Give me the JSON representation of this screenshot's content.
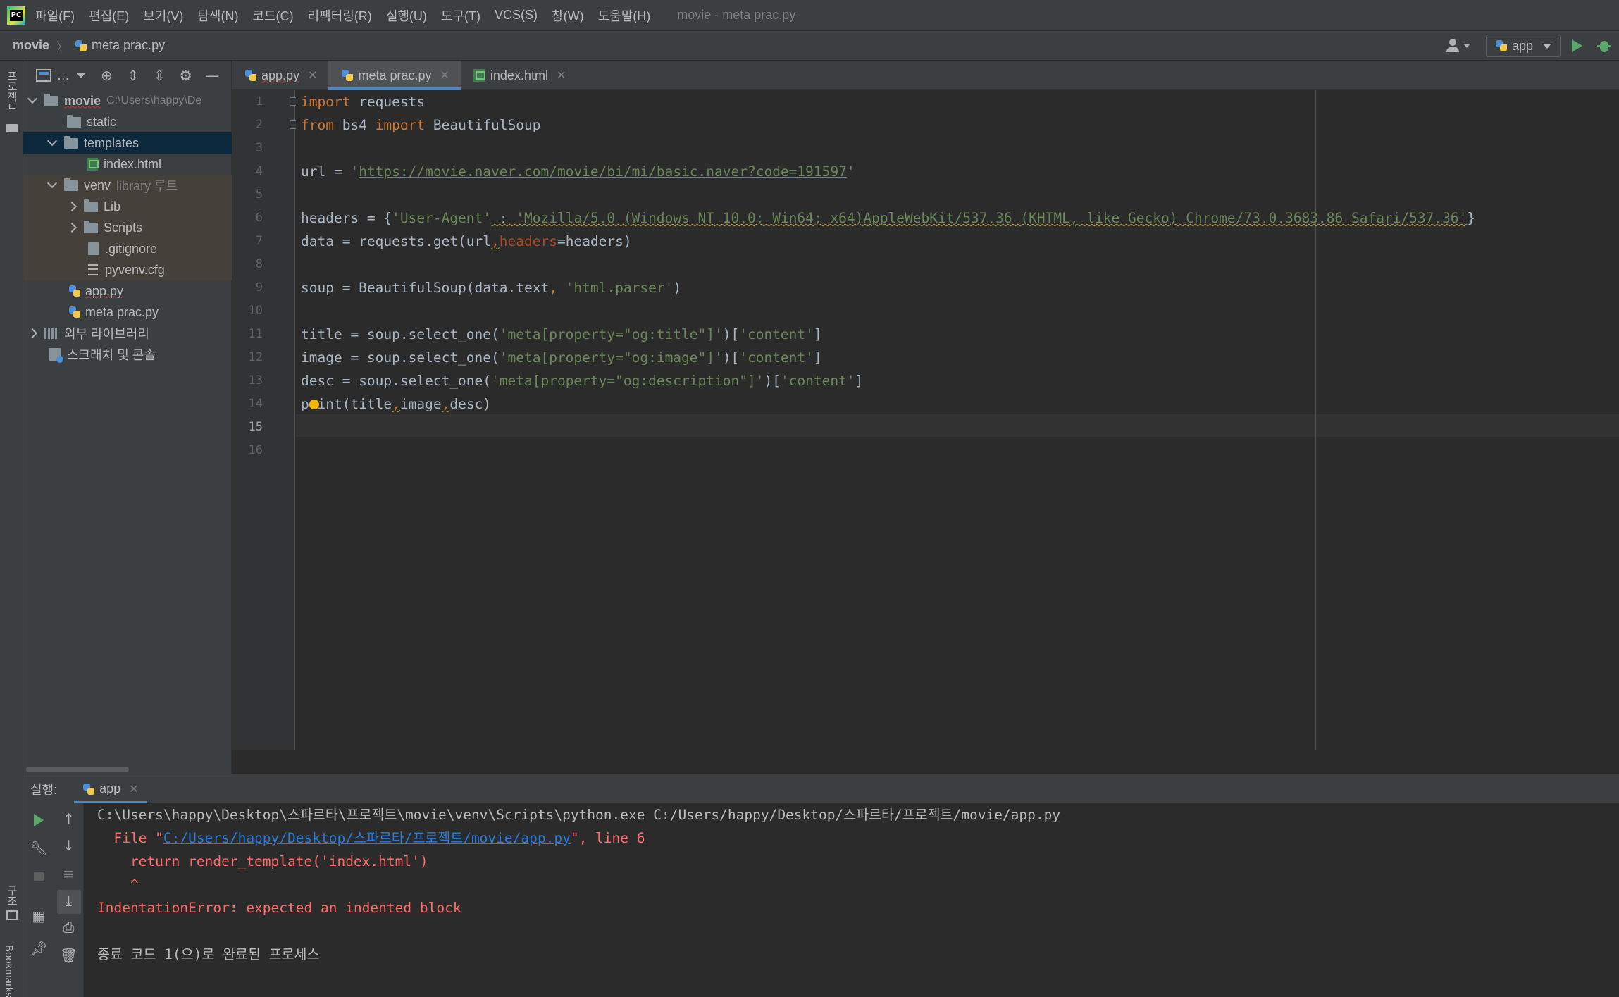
{
  "menubar": {
    "items": [
      "파일(F)",
      "편집(E)",
      "보기(V)",
      "탐색(N)",
      "코드(C)",
      "리팩터링(R)",
      "실행(U)",
      "도구(T)",
      "VCS(S)",
      "창(W)",
      "도움말(H)"
    ],
    "window_title": "movie - meta prac.py"
  },
  "navbar": {
    "project": "movie",
    "file": "meta prac.py",
    "run_config": "app"
  },
  "left_strip": {
    "project_label": "프로젝트",
    "structure_label": "구조",
    "bookmarks_label": "Bookmarks"
  },
  "project_tree": {
    "root": {
      "name": "movie",
      "path": "C:\\Users\\happy\\De"
    },
    "static": "static",
    "templates": "templates",
    "index_html": "index.html",
    "venv": {
      "name": "venv",
      "tag": "library 루트"
    },
    "lib": "Lib",
    "scripts": "Scripts",
    "gitignore": ".gitignore",
    "pyvenv": "pyvenv.cfg",
    "app_py": "app.py",
    "meta_prac": "meta prac.py",
    "external_libs": "외부 라이브러리",
    "scratches": "스크래치 및 콘솔"
  },
  "tabs": [
    {
      "label": "app.py"
    },
    {
      "label": "meta prac.py"
    },
    {
      "label": "index.html"
    }
  ],
  "editor": {
    "line_numbers": [
      "1",
      "2",
      "3",
      "4",
      "5",
      "6",
      "7",
      "8",
      "9",
      "10",
      "11",
      "12",
      "13",
      "14",
      "15",
      "16"
    ],
    "code": {
      "l1_kw": "import",
      "l1_rest": " requests",
      "l2_kw1": "from",
      "l2_mid": " bs4 ",
      "l2_kw2": "import",
      "l2_rest": " BeautifulSoup",
      "l4_a": "url = ",
      "l4_q1": "'",
      "l4_url": "https://movie.naver.com/movie/bi/mi/basic.naver?code=191597",
      "l4_q2": "'",
      "l6_a": "headers = {",
      "l6_key": "'User-Agent'",
      "l6_colon": " : ",
      "l6_val": "'Mozilla/5.0 (Windows NT 10.0; Win64; x64)AppleWebKit/537.36 (KHTML, like Gecko) Chrome/73.0.3683.86 Safari/537.36'",
      "l6_end": "}",
      "l7_a": "data = requests.get(url",
      "l7_comma": ",",
      "l7_param": "headers",
      "l7_rest": "=headers)",
      "l9_a": "soup = BeautifulSoup(data.text",
      "l9_comma": ", ",
      "l9_str": "'html.parser'",
      "l9_end": ")",
      "l11_a": "title = soup.select_one(",
      "l11_s1": "'meta[property=\"og:title\"]'",
      "l11_b": ")[",
      "l11_s2": "'content'",
      "l11_c": "]",
      "l12_a": "image = soup.select_one(",
      "l12_s1": "'meta[property=\"og:image\"]'",
      "l12_b": ")[",
      "l12_s2": "'content'",
      "l12_c": "]",
      "l13_a": "desc = soup.select_one(",
      "l13_s1": "'meta[property=\"og:description\"]'",
      "l13_b": ")[",
      "l13_s2": "'content'",
      "l13_c": "]",
      "l14_a": "print(title",
      "l14_c1": ",",
      "l14_b": "image",
      "l14_c2": ",",
      "l14_d": "desc)"
    }
  },
  "run_panel": {
    "label": "실행:",
    "tab": "app",
    "console": {
      "line1": "C:\\Users\\happy\\Desktop\\스파르타\\프로젝트\\movie\\venv\\Scripts\\python.exe C:/Users/happy/Desktop/스파르타/프로젝트/movie/app.py",
      "line2_a": "  File \"",
      "line2_link": "C:/Users/happy/Desktop/스파르타/프로젝트/movie/app.py",
      "line2_b": "\", line 6",
      "line3": "    return render_template('index.html')",
      "line4": "    ^",
      "line5": "IndentationError: expected an indented block",
      "line7": "종료 코드 1(으)로 완료된 프로세스"
    }
  },
  "colors": {
    "keyword": "#cc7832",
    "string": "#6a8759",
    "error": "#ff6b68",
    "accent": "#4a88c7"
  }
}
